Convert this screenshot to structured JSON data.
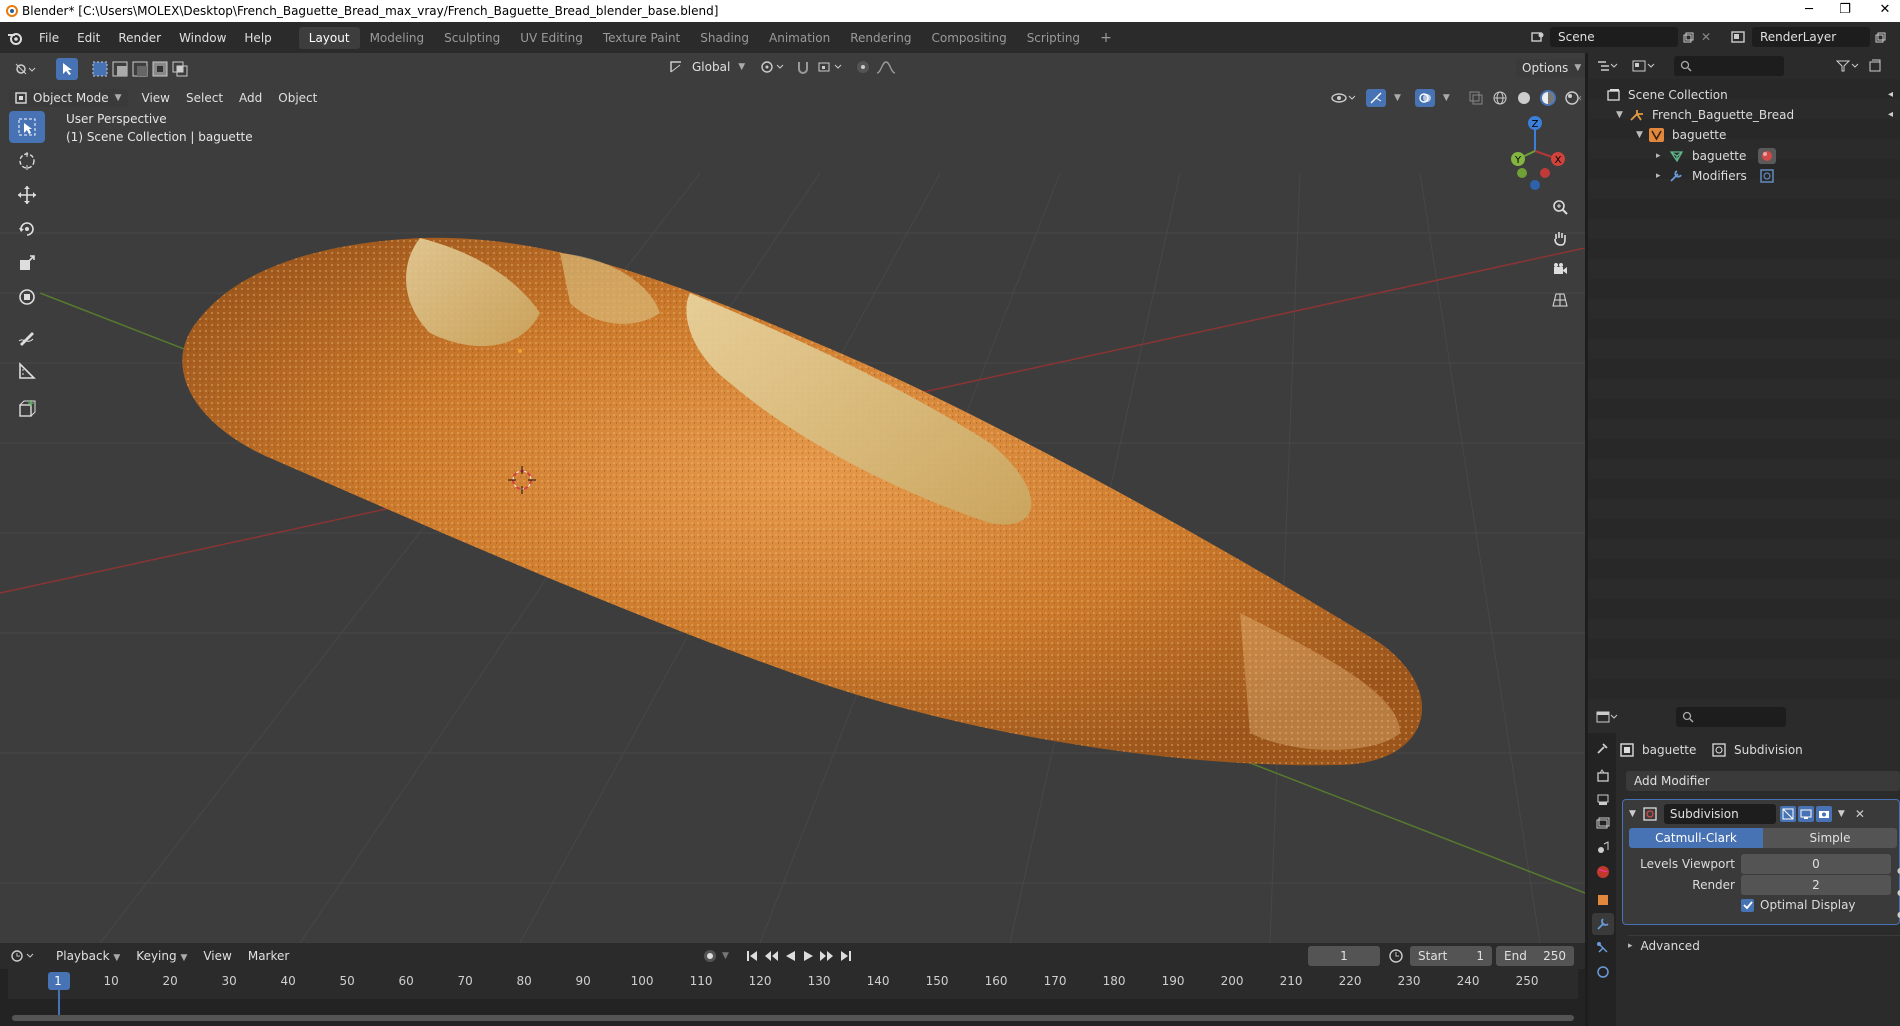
{
  "titlebar": {
    "title": "Blender* [C:\\Users\\MOLEX\\Desktop\\French_Baguette_Bread_max_vray/French_Baguette_Bread_blender_base.blend]",
    "minimize": "─",
    "maximize": "❐",
    "close": "✕"
  },
  "menu": [
    "File",
    "Edit",
    "Render",
    "Window",
    "Help"
  ],
  "workspaces": [
    "Layout",
    "Modeling",
    "Sculpting",
    "UV Editing",
    "Texture Paint",
    "Shading",
    "Animation",
    "Rendering",
    "Compositing",
    "Scripting"
  ],
  "active_workspace": "Layout",
  "add_workspace": "+",
  "scene_name": "Scene",
  "render_layer": "RenderLayer",
  "viewport": {
    "transform_orientation": "Global",
    "options_label": "Options",
    "mode": "Object Mode",
    "view_menu": [
      "View",
      "Select",
      "Add",
      "Object"
    ],
    "overlay_line1": "User Perspective",
    "overlay_line2": "(1) Scene Collection | baguette",
    "gizmo_axes": {
      "x": "X",
      "y": "Y",
      "z": "Z"
    }
  },
  "outliner": {
    "rows": [
      {
        "label": "Scene Collection",
        "icon": "collection-icon"
      },
      {
        "label": "French_Baguette_Bread",
        "icon": "armature-icon"
      },
      {
        "label": "baguette",
        "icon": "object-icon"
      },
      {
        "label": "baguette",
        "icon": "mesh-icon"
      },
      {
        "label": "Modifiers",
        "icon": "wrench-icon"
      }
    ]
  },
  "properties": {
    "object_name": "baguette",
    "modifier_tab_name": "Subdivision",
    "add_modifier": "Add Modifier",
    "modifier_name": "Subdivision",
    "type_options": [
      "Catmull-Clark",
      "Simple"
    ],
    "active_type": "Catmull-Clark",
    "levels_viewport_label": "Levels Viewport",
    "levels_viewport_value": "0",
    "render_label": "Render",
    "render_value": "2",
    "optimal_display_label": "Optimal Display",
    "optimal_display_checked": true,
    "advanced_label": "Advanced"
  },
  "timeline": {
    "menus": [
      "Playback",
      "Keying",
      "View",
      "Marker"
    ],
    "current_frame": "1",
    "start_label": "Start",
    "start_value": "1",
    "end_label": "End",
    "end_value": "250",
    "ticks": [
      "1",
      "10",
      "20",
      "30",
      "40",
      "50",
      "60",
      "70",
      "80",
      "90",
      "100",
      "110",
      "120",
      "130",
      "140",
      "150",
      "160",
      "170",
      "180",
      "190",
      "200",
      "210",
      "220",
      "230",
      "240",
      "250"
    ]
  },
  "colors": {
    "accent": "#4772b3",
    "viewport_bg": "#3d3d3d",
    "x_axis": "#b23838",
    "y_axis": "#6b9e37",
    "z_axis": "#3b7fd8",
    "playhead": "#4772b3"
  }
}
